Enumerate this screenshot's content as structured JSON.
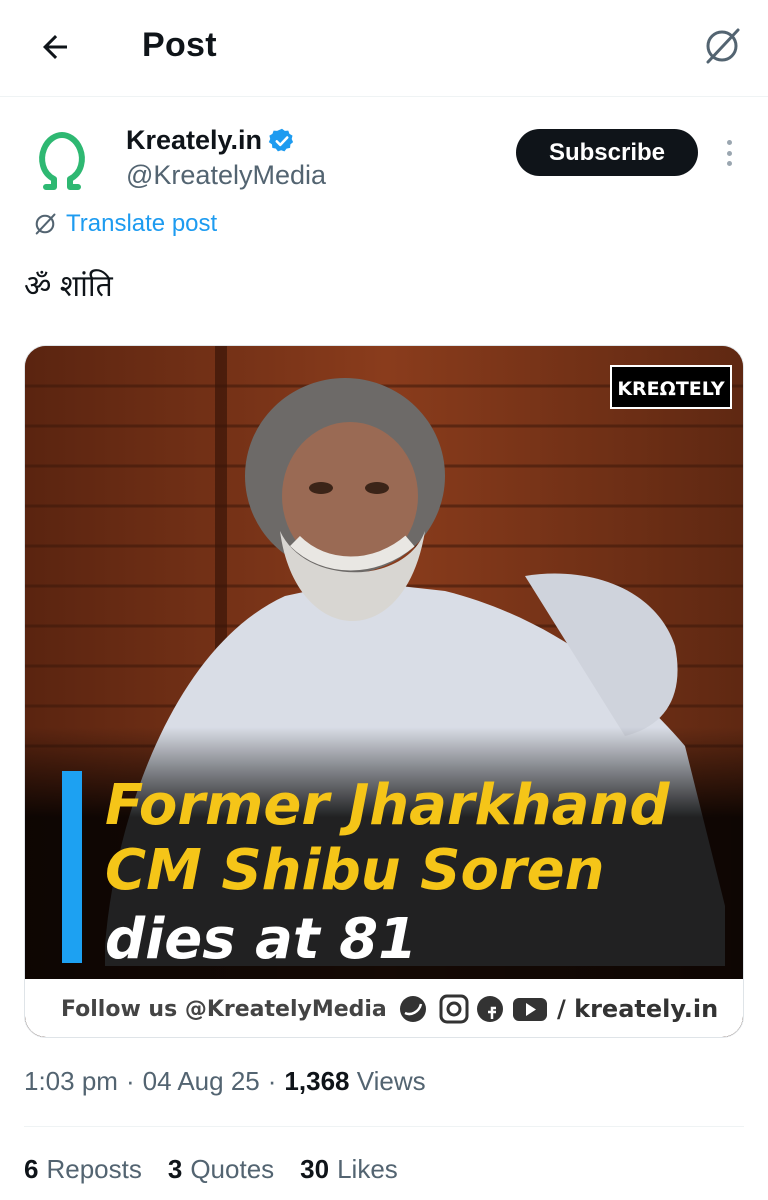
{
  "header": {
    "title": "Post",
    "back_icon": "arrow-left-icon",
    "grok_icon": "grok-icon"
  },
  "author": {
    "display_name": "Kreately.in",
    "handle": "@KreatelyMedia",
    "verified": true,
    "avatar_icon": "omega-logo-icon",
    "avatar_color": "#2eb872",
    "subscribe_label": "Subscribe"
  },
  "translate": {
    "label": "Translate post",
    "icon": "grok-icon"
  },
  "post": {
    "text": "ॐ शांति"
  },
  "media": {
    "watermark": "KREΩTELY",
    "headline_lines": [
      "Former Jharkhand",
      "CM Shibu Soren",
      "dies at 81"
    ],
    "footer_follow": "Follow us @KreatelyMedia",
    "footer_site": "/ kreately.in",
    "social_icons": [
      "twitter-icon",
      "instagram-icon",
      "facebook-icon",
      "youtube-icon"
    ],
    "headline_color": "#f5c518",
    "accent_bar_color": "#1da1f2"
  },
  "meta": {
    "time": "1:03 pm",
    "date": "04 Aug 25",
    "views_count": "1,368",
    "views_label": "Views"
  },
  "stats": {
    "reposts_count": "6",
    "reposts_label": "Reposts",
    "quotes_count": "3",
    "quotes_label": "Quotes",
    "likes_count": "30",
    "likes_label": "Likes"
  }
}
